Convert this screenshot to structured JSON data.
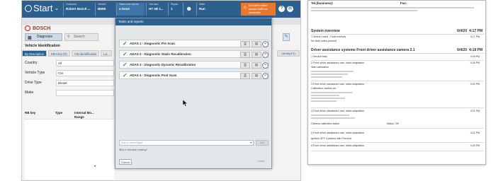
{
  "topbar": {
    "start_label": "Start",
    "customer_label": "Customer",
    "customer_value": "Robert Bosch ...",
    "vehicle_label": "Vehicle",
    "vehicle_value": "BMW",
    "tasks_label": "Tasks and reports",
    "tasks_value": "4 Done",
    "job_label": "Job card",
    "job_value": "HT 0B 2...",
    "repair_label": "Repair",
    "repair_value": "1",
    "user_icon": "user-icon",
    "state_label": "State",
    "state_value": "Run",
    "warning_text": "No CoRe Online service DMS not accessible",
    "help_label": "?",
    "menu_label": "☰"
  },
  "app": {
    "bosch_label": "BOSCH",
    "diagnosis_label": "Diagnosis",
    "search_label": "Search",
    "vehicle_identification_title": "Vehicle Identification",
    "tabs": [
      {
        "label": "By Description",
        "active": true
      },
      {
        "label": "KBA key (D)",
        "active": false
      },
      {
        "label": "VIN identification",
        "active": false
      },
      {
        "label": "La...",
        "active": false
      }
    ],
    "right_tab_label": "Identify(F3)",
    "fields": [
      {
        "label": "Country",
        "value": "All"
      },
      {
        "label": "Vehicle Type",
        "value": "Car"
      },
      {
        "label": "Drive Type",
        "value": "Diesel"
      },
      {
        "label": "Make",
        "value": ""
      }
    ],
    "columns": [
      "RB key",
      "Type",
      "Internal Mo... Range"
    ]
  },
  "modal": {
    "title": "Tasks and reports",
    "tasks": [
      {
        "label": "ADAS 1 - Diagnostic Pre Scan"
      },
      {
        "label": "ADAS 2 - Diagnostic Static Recalibration"
      },
      {
        "label": "ADAS 3 - Diagnostic Dynamic Recalibration"
      },
      {
        "label": "ADAS 4 - Diagnostic Post Scan"
      }
    ],
    "add_placeholder": "Add or select type",
    "add_button": "Add",
    "why_link": "Why is this task missing?",
    "cancel_button": "Cancel",
    "close_button": "Close"
  },
  "report": {
    "tel_label": "Tel.(business):",
    "fax_label": "Fax:",
    "section1": {
      "title": "System overview",
      "date": "6/4/20",
      "time": "4:17 PM",
      "lines": [
        {
          "text": "1  Search result - Fault memory",
          "time": "4:17 PM"
        },
        {
          "text": "No fault codes present",
          "time": ""
        }
      ]
    },
    "section2": {
      "title": "Driver assistance systems Front driver assistance camera 2.1",
      "date": "6/4/20",
      "time": "4:18 PM",
      "lines": [
        {
          "text": "1  Service task",
          "time": "4:18 PM"
        },
        {
          "text": "2  Front driver assistance cam. static adaptation",
          "time": "4:18 PM"
        },
        {
          "text": "Start calibration",
          "time": ""
        },
        {
          "text": "3  Front driver assistance cam. static adaptation",
          "time": "4:20 PM"
        },
        {
          "text": "Calibration carried out",
          "time": ""
        },
        {
          "text": "4  Front driver assistance cam. static adaptation",
          "time": "4:21 PM"
        },
        {
          "text": "Camera calibrated status",
          "time": "Status: OK"
        },
        {
          "text": "5  Front driver assistance cam. static adaptation",
          "time": "4:21 PM"
        },
        {
          "text": "Ignition OFF Continue with Proceed",
          "time": ""
        },
        {
          "text": "6  Front driver assistance cam. static adaptation",
          "time": "4:25 PM"
        }
      ]
    }
  }
}
